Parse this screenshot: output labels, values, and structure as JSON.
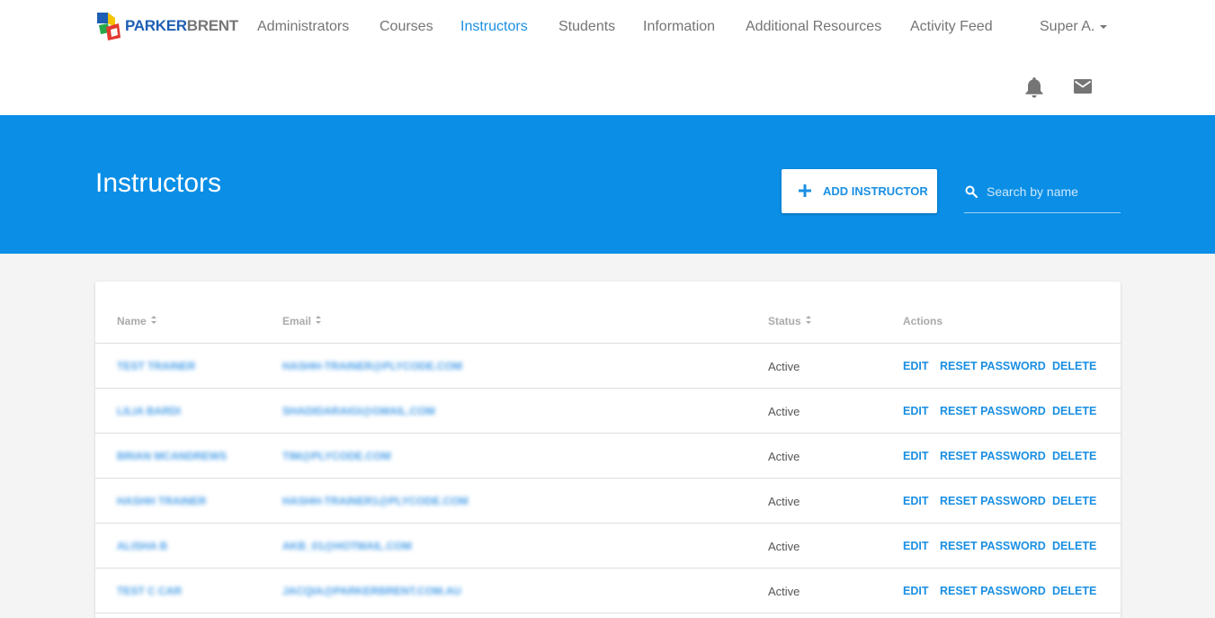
{
  "brand": {
    "part1": "PARKER",
    "part2": "BRENT"
  },
  "nav": [
    {
      "label": "Administrators",
      "active": false
    },
    {
      "label": "Courses",
      "active": false
    },
    {
      "label": "Instructors",
      "active": true
    },
    {
      "label": "Students",
      "active": false
    },
    {
      "label": "Information",
      "active": false
    },
    {
      "label": "Additional Resources",
      "active": false
    },
    {
      "label": "Activity Feed",
      "active": false
    }
  ],
  "user": {
    "name": "Super A."
  },
  "icons": {
    "notifications": "bell-icon",
    "messages": "mail-icon",
    "add": "plus-icon",
    "search": "search-icon"
  },
  "colors": {
    "accent": "#0a8ee6",
    "link": "#1a8fe3"
  },
  "page": {
    "title": "Instructors",
    "add_button": "ADD INSTRUCTOR",
    "search_placeholder": "Search by name"
  },
  "table": {
    "columns": {
      "name": "Name",
      "email": "Email",
      "status": "Status",
      "actions": "Actions"
    },
    "action_labels": {
      "edit": "EDIT",
      "reset": "RESET PASSWORD",
      "delete": "DELETE"
    },
    "rows": [
      {
        "name": "TEST TRAINER",
        "email": "HASHH-TRAINER@PLYCODE.COM",
        "status": "Active"
      },
      {
        "name": "LILIA BARDI",
        "email": "SHADIDARAIGI@GMAIL.COM",
        "status": "Active"
      },
      {
        "name": "BRIAN MCANDREWS",
        "email": "TIM@PLYCODE.COM",
        "status": "Active"
      },
      {
        "name": "HASHH TRAINER",
        "email": "HASHH-TRAINER1@PLYCODE.COM",
        "status": "Active"
      },
      {
        "name": "ALISHA B",
        "email": "AKB_01@HOTMAIL.COM",
        "status": "Active"
      },
      {
        "name": "TEST C CAR",
        "email": "JACQIA@PARKERBRENT.COM.AU",
        "status": "Active"
      }
    ]
  }
}
